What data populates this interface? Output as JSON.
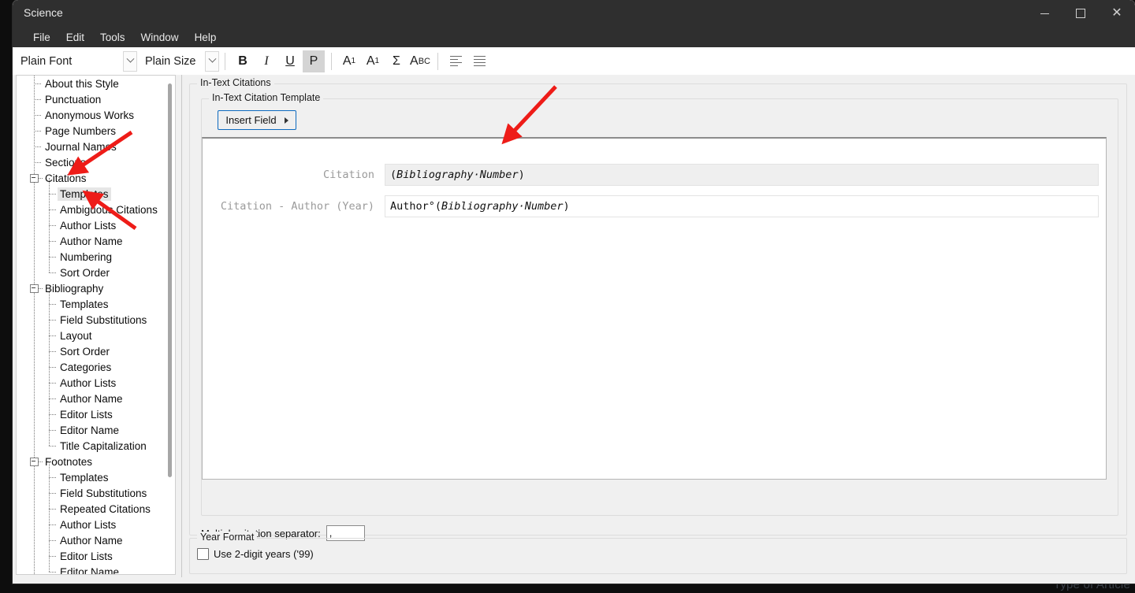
{
  "window": {
    "title": "Science",
    "buttons": {
      "minimize": "minimize-button",
      "maximize": "maximize-button",
      "close": "close-button"
    }
  },
  "menubar": {
    "items": [
      "File",
      "Edit",
      "Tools",
      "Window",
      "Help"
    ]
  },
  "toolbar": {
    "font_combo": "Plain Font",
    "size_combo": "Plain Size",
    "bold": "B",
    "italic": "I",
    "underline": "U",
    "plain": "P",
    "superscript": "A",
    "superscript_mark": "1",
    "subscript": "A",
    "subscript_mark": "1",
    "symbol": "Σ",
    "smallcaps_a": "A",
    "smallcaps_rest": "BC"
  },
  "tree": {
    "nodes": [
      {
        "label": "About this Style",
        "level": 0,
        "expander": false,
        "selected": false
      },
      {
        "label": "Punctuation",
        "level": 0,
        "expander": false,
        "selected": false
      },
      {
        "label": "Anonymous Works",
        "level": 0,
        "expander": false,
        "selected": false
      },
      {
        "label": "Page Numbers",
        "level": 0,
        "expander": false,
        "selected": false
      },
      {
        "label": "Journal Names",
        "level": 0,
        "expander": false,
        "selected": false
      },
      {
        "label": "Sections",
        "level": 0,
        "expander": false,
        "selected": false
      },
      {
        "label": "Citations",
        "level": 0,
        "expander": true,
        "selected": false
      },
      {
        "label": "Templates",
        "level": 1,
        "expander": false,
        "selected": true
      },
      {
        "label": "Ambiguous Citations",
        "level": 1,
        "expander": false,
        "selected": false
      },
      {
        "label": "Author Lists",
        "level": 1,
        "expander": false,
        "selected": false
      },
      {
        "label": "Author Name",
        "level": 1,
        "expander": false,
        "selected": false
      },
      {
        "label": "Numbering",
        "level": 1,
        "expander": false,
        "selected": false
      },
      {
        "label": "Sort Order",
        "level": 1,
        "expander": false,
        "selected": false
      },
      {
        "label": "Bibliography",
        "level": 0,
        "expander": true,
        "selected": false
      },
      {
        "label": "Templates",
        "level": 1,
        "expander": false,
        "selected": false
      },
      {
        "label": "Field Substitutions",
        "level": 1,
        "expander": false,
        "selected": false
      },
      {
        "label": "Layout",
        "level": 1,
        "expander": false,
        "selected": false
      },
      {
        "label": "Sort Order",
        "level": 1,
        "expander": false,
        "selected": false
      },
      {
        "label": "Categories",
        "level": 1,
        "expander": false,
        "selected": false
      },
      {
        "label": "Author Lists",
        "level": 1,
        "expander": false,
        "selected": false
      },
      {
        "label": "Author Name",
        "level": 1,
        "expander": false,
        "selected": false
      },
      {
        "label": "Editor Lists",
        "level": 1,
        "expander": false,
        "selected": false
      },
      {
        "label": "Editor Name",
        "level": 1,
        "expander": false,
        "selected": false
      },
      {
        "label": "Title Capitalization",
        "level": 1,
        "expander": false,
        "selected": false
      },
      {
        "label": "Footnotes",
        "level": 0,
        "expander": true,
        "selected": false
      },
      {
        "label": "Templates",
        "level": 1,
        "expander": false,
        "selected": false
      },
      {
        "label": "Field Substitutions",
        "level": 1,
        "expander": false,
        "selected": false
      },
      {
        "label": "Repeated Citations",
        "level": 1,
        "expander": false,
        "selected": false
      },
      {
        "label": "Author Lists",
        "level": 1,
        "expander": false,
        "selected": false
      },
      {
        "label": "Author Name",
        "level": 1,
        "expander": false,
        "selected": false
      },
      {
        "label": "Editor Lists",
        "level": 1,
        "expander": false,
        "selected": false
      },
      {
        "label": "Editor Name",
        "level": 1,
        "expander": false,
        "selected": false
      }
    ]
  },
  "main": {
    "group_intext_citations": "In-Text Citations",
    "group_citation_template": "In-Text Citation Template",
    "insert_field_button": "Insert Field",
    "rows": [
      {
        "label": "Citation",
        "readonly": true,
        "parts": [
          {
            "text": "(",
            "style": "plain"
          },
          {
            "text": "Bibliography·Number",
            "style": "field"
          },
          {
            "text": ")",
            "style": "plain"
          }
        ]
      },
      {
        "label": "Citation - Author (Year)",
        "readonly": false,
        "parts": [
          {
            "text": "Author°(",
            "style": "plain"
          },
          {
            "text": "Bibliography·Number",
            "style": "field"
          },
          {
            "text": ")",
            "style": "plain"
          }
        ]
      }
    ],
    "separator_label": "Multiple citation separator:",
    "separator_value": ",",
    "group_year_format": "Year Format",
    "two_digit_years_label": "Use 2-digit years ('99)",
    "two_digit_years_checked": false
  },
  "desktop": {
    "background_text": "Type of Article"
  },
  "annotations": {
    "accent_color": "#ee1c18",
    "arrows": [
      {
        "name": "arrow-to-citations-node"
      },
      {
        "name": "arrow-to-templates-node"
      },
      {
        "name": "arrow-to-citation-field"
      }
    ]
  }
}
